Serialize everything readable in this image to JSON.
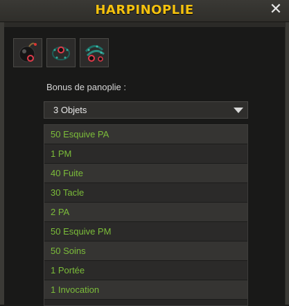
{
  "window": {
    "title": "HARPINOPLIE",
    "close_symbol": "✕"
  },
  "set_items": [
    {
      "name": "item-1",
      "icon": "bomb-icon"
    },
    {
      "name": "item-2",
      "icon": "ring-icon"
    },
    {
      "name": "item-3",
      "icon": "bracelet-icon"
    }
  ],
  "panoply": {
    "label": "Bonus de panoplie :",
    "selected": "3 Objets",
    "bonuses": [
      "50 Esquive PA",
      "1 PM",
      "40 Fuite",
      "30 Tacle",
      "2 PA",
      "50 Esquive PM",
      "50 Soins",
      "1 Portée",
      "1 Invocation"
    ]
  },
  "colors": {
    "title": "#f5c20e",
    "bonus_text": "#7cbd3a"
  }
}
